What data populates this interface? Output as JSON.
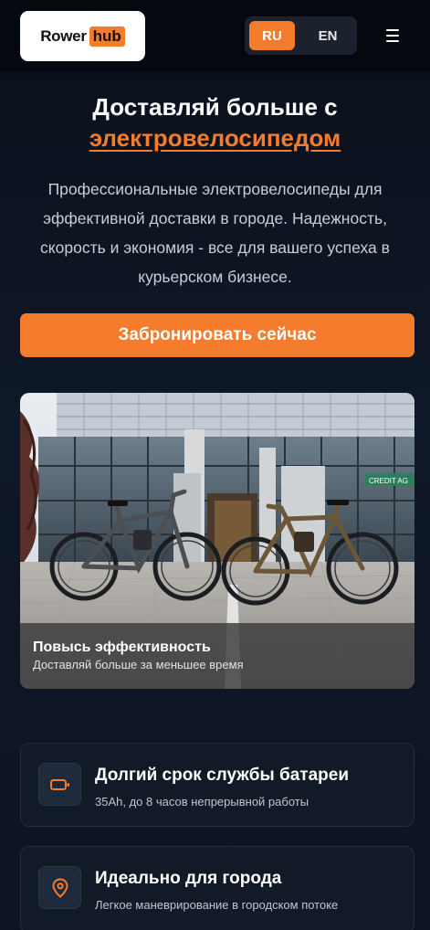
{
  "header": {
    "logo": {
      "word": "Rower",
      "accent": "hub"
    },
    "languages": [
      {
        "code": "RU",
        "active": true
      },
      {
        "code": "EN",
        "active": false
      }
    ],
    "menu_icon": "hamburger-menu-icon"
  },
  "hero": {
    "title_line1": "Доставляй больше с",
    "title_accent": "электровелосипедом",
    "description": "Профессиональные электровелосипеды для эффективной доставки в городе. Надежность, скорость и экономия - все для вашего успеха в курьерском бизнесе.",
    "cta_label": "Забронировать сейчас"
  },
  "photo_card": {
    "title": "Повысь эффективность",
    "subtitle": "Доставляй больше за меньшее время",
    "signage": "CREDIT AG"
  },
  "features": [
    {
      "icon": "battery-icon",
      "title": "Долгий срок службы батареи",
      "subtitle": "35Ah, до 8 часов непрерывной работы"
    },
    {
      "icon": "map-pin-icon",
      "title": "Идеально для города",
      "subtitle": "Легкое маневрирование в городском потоке"
    }
  ],
  "colors": {
    "accent": "#f47c2c",
    "background": "#0c1322",
    "card": "#121a28"
  }
}
